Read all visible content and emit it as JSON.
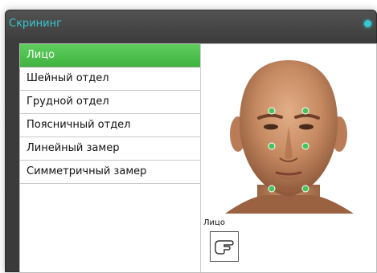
{
  "window": {
    "title": "Скрининг"
  },
  "menu": {
    "items": [
      {
        "label": "Лицо",
        "active": true
      },
      {
        "label": "Шейный отдел",
        "active": false
      },
      {
        "label": "Грудной отдел",
        "active": false
      },
      {
        "label": "Поясничный отдел",
        "active": false
      },
      {
        "label": "Линейный замер",
        "active": false
      },
      {
        "label": "Симметричный замер",
        "active": false
      }
    ]
  },
  "face": {
    "section_label": "Лицо",
    "marker_color": "#46c35a"
  },
  "colors": {
    "title_accent": "#35c9d2",
    "active_item": "#4cbf4c"
  }
}
